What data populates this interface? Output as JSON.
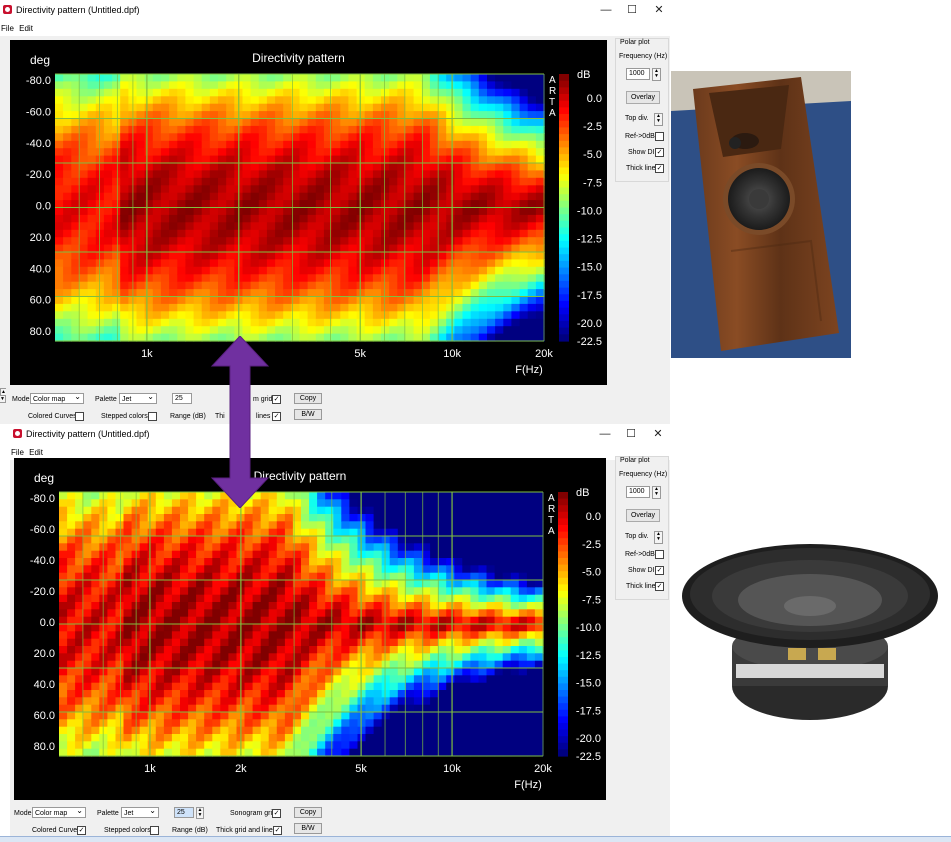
{
  "colors": {
    "arrow": "#7030a0",
    "plot_bg": "#000000",
    "grid": "#7fbf3f"
  },
  "windows": [
    {
      "title": "Directivity pattern (Untitled.dpf)",
      "menu": [
        "File",
        "Edit"
      ],
      "controls": {
        "minimize": "—",
        "maximize": "☐",
        "close": "✕"
      },
      "plot": {
        "title": "Directivity pattern",
        "y_unit": "deg",
        "x_unit": "F(Hz)",
        "colorbar_unit": "dB",
        "y_ticks": [
          "-80.0",
          "-60.0",
          "-40.0",
          "-20.0",
          "0.0",
          "20.0",
          "40.0",
          "60.0",
          "80.0"
        ],
        "x_ticks": [
          "1k",
          "5k",
          "10k",
          "20k"
        ],
        "colorbar_ticks": [
          "0.0",
          "-2.5",
          "-5.0",
          "-7.5",
          "-10.0",
          "-12.5",
          "-15.0",
          "-17.5",
          "-20.0",
          "-22.5"
        ],
        "watermark": [
          "A",
          "R",
          "T",
          "A"
        ]
      },
      "side": {
        "polar": "Polar plot",
        "freq_label": "Frequency (Hz)",
        "freq_value": "1000",
        "overlay": "Overlay",
        "top_div": "Top div.",
        "ref": "Ref->0dB",
        "ref_checked": false,
        "show_di": "Show DI",
        "show_di_checked": true,
        "thick": "Thick line",
        "thick_checked": true
      },
      "bottom": {
        "mode_label": "Mode",
        "mode_value": "Color map",
        "palette_label": "Palette",
        "palette_value": "Jet",
        "range_value": "25",
        "range_label": "Range (dB)",
        "colored_label": "Colored Curves",
        "colored_checked": false,
        "stepped_label": "Stepped colors",
        "stepped_checked": false,
        "sono_label": "m grid",
        "sono_checked": true,
        "thick_label": "Thi",
        "thick_label_b": "lines",
        "thick_checked": true,
        "copy": "Copy",
        "bw": "B/W"
      }
    },
    {
      "title": "Directivity pattern (Untitled.dpf)",
      "menu": [
        "File",
        "Edit"
      ],
      "controls": {
        "minimize": "—",
        "maximize": "☐",
        "close": "✕"
      },
      "plot": {
        "title": "Directivity pattern",
        "y_unit": "deg",
        "x_unit": "F(Hz)",
        "colorbar_unit": "dB",
        "y_ticks": [
          "-80.0",
          "-60.0",
          "-40.0",
          "-20.0",
          "0.0",
          "20.0",
          "40.0",
          "60.0",
          "80.0"
        ],
        "x_ticks": [
          "1k",
          "2k",
          "5k",
          "10k",
          "20k"
        ],
        "colorbar_ticks": [
          "0.0",
          "-2.5",
          "-5.0",
          "-7.5",
          "-10.0",
          "-12.5",
          "-15.0",
          "-17.5",
          "-20.0",
          "-22.5"
        ],
        "watermark": [
          "A",
          "R",
          "T",
          "A"
        ]
      },
      "side": {
        "polar": "Polar plot",
        "freq_label": "Frequency (Hz)",
        "freq_value": "1000",
        "overlay": "Overlay",
        "top_div": "Top div.",
        "ref": "Ref->0dB",
        "ref_checked": false,
        "show_di": "Show DI",
        "show_di_checked": true,
        "thick": "Thick line",
        "thick_checked": true
      },
      "bottom": {
        "mode_label": "Mode",
        "mode_value": "Color map",
        "palette_label": "Palette",
        "palette_value": "Jet",
        "range_value": "25",
        "range_label": "Range (dB)",
        "colored_label": "Colored Curves",
        "colored_checked": true,
        "stepped_label": "Stepped colors",
        "stepped_checked": false,
        "sono_label": "Sonogram grid",
        "sono_checked": true,
        "thick_label": "Thick grid and  lines",
        "thick_label_b": "",
        "thick_checked": true,
        "copy": "Copy",
        "bw": "B/W"
      }
    }
  ]
}
